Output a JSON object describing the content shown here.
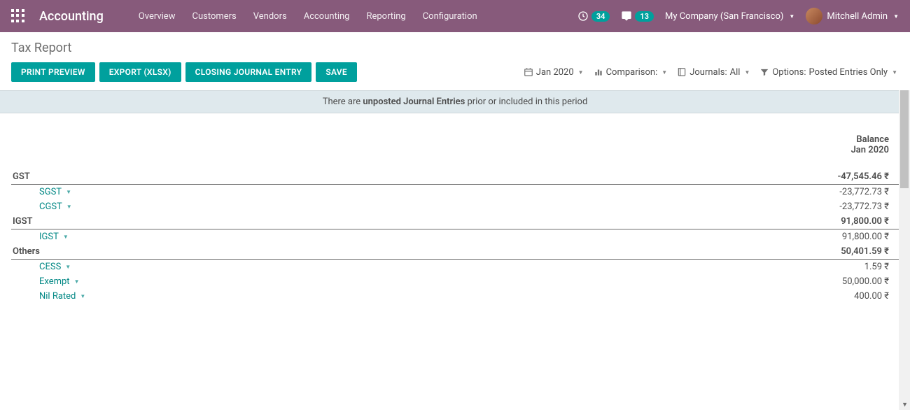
{
  "navbar": {
    "brand": "Accounting",
    "links": [
      "Overview",
      "Customers",
      "Vendors",
      "Accounting",
      "Reporting",
      "Configuration"
    ],
    "activity_count": "34",
    "message_count": "13",
    "company": "My Company (San Francisco)",
    "user": "Mitchell Admin"
  },
  "page": {
    "title": "Tax Report",
    "buttons": {
      "print": "PRINT PREVIEW",
      "export": "EXPORT (XLSX)",
      "closing": "CLOSING JOURNAL ENTRY",
      "save": "SAVE"
    }
  },
  "filters": {
    "period": "Jan 2020",
    "comparison_label": "Comparison:",
    "journals_label": "Journals:",
    "journals_value": "All",
    "options_label": "Options:",
    "options_value": "Posted Entries Only"
  },
  "banner": {
    "prefix": "There are ",
    "bold": "unposted Journal Entries",
    "suffix": " prior or included in this period"
  },
  "column_header": {
    "line1": "Balance",
    "line2": "Jan 2020"
  },
  "rows": {
    "gst": {
      "label": "GST",
      "balance": "-47,545.46 ₹"
    },
    "sgst": {
      "label": "SGST",
      "balance": "-23,772.73 ₹"
    },
    "cgst": {
      "label": "CGST",
      "balance": "-23,772.73 ₹"
    },
    "igst_group": {
      "label": "IGST",
      "balance": "91,800.00 ₹"
    },
    "igst": {
      "label": "IGST",
      "balance": "91,800.00 ₹"
    },
    "others": {
      "label": "Others",
      "balance": "50,401.59 ₹"
    },
    "cess": {
      "label": "CESS",
      "balance": "1.59 ₹"
    },
    "exempt": {
      "label": "Exempt",
      "balance": "50,000.00 ₹"
    },
    "nil": {
      "label": "Nil Rated",
      "balance": "400.00 ₹"
    }
  }
}
